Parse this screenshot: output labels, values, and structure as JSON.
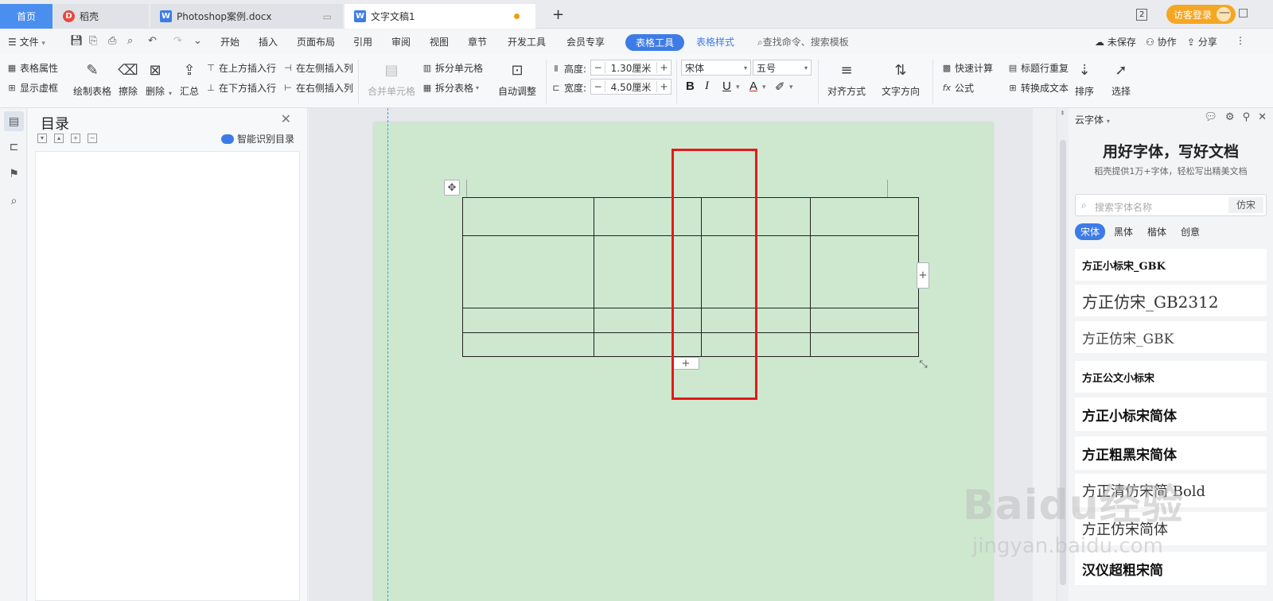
{
  "tabs": {
    "home": "首页",
    "daoke": "稻壳",
    "doc1": "Photoshop案例.docx",
    "doc2": "文字文稿1",
    "add": "+"
  },
  "titlebar": {
    "badge": "2",
    "visitor": "访客登录",
    "minimize": "—",
    "maximize": "□"
  },
  "menu": {
    "file": "文件",
    "items": [
      "开始",
      "插入",
      "页面布局",
      "引用",
      "审阅",
      "视图",
      "章节",
      "开发工具",
      "会员专享"
    ],
    "table_tools": "表格工具",
    "table_style": "表格样式",
    "search": "查找命令、搜索模板",
    "unsaved": "未保存",
    "collab": "协作",
    "share": "分享"
  },
  "ribbon": {
    "table_props": "表格属性",
    "show_grid": "显示虚框",
    "draw_table": "绘制表格",
    "erase": "擦除",
    "delete": "删除",
    "summary": "汇总",
    "insert_above": "在上方插入行",
    "insert_below": "在下方插入行",
    "insert_left": "在左侧插入列",
    "insert_right": "在右侧插入列",
    "merge_cells": "合并单元格",
    "split_cells": "拆分单元格",
    "split_table": "拆分表格",
    "auto_fit": "自动调整",
    "height_label": "高度:",
    "height_value": "1.30厘米",
    "width_label": "宽度:",
    "width_value": "4.50厘米",
    "font_name": "宋体",
    "font_size": "五号",
    "bold": "B",
    "italic": "I",
    "underline": "U",
    "font_color": "A",
    "align": "对齐方式",
    "text_dir": "文字方向",
    "quick_calc": "快速计算",
    "formula": "公式",
    "title_repeat": "标题行重复",
    "to_text": "转换成文本",
    "sort": "排序",
    "select": "选择"
  },
  "toc": {
    "title": "目录",
    "smart": "智能识别目录"
  },
  "font_panel": {
    "header": "云字体",
    "title": "用好字体，写好文档",
    "subtitle": "稻壳提供1万+字体，轻松写出精美文档",
    "search_placeholder": "搜索字体名称",
    "search_btn": "仿宋",
    "categories": [
      "宋体",
      "黑体",
      "楷体",
      "创意"
    ],
    "fonts": [
      "方正小标宋_GBK",
      "方正仿宋_GB2312",
      "方正仿宋_GBK",
      "方正公文小标宋",
      "方正小标宋简体",
      "方正粗黑宋简体",
      "方正清仿宋简 Bold",
      "方正仿宋简体",
      "汉仪超粗宋简"
    ]
  },
  "watermark": {
    "brand": "Baidu经验",
    "url": "jingyan.baidu.com"
  },
  "colors": {
    "accent": "#3d7ce6",
    "page_bg": "#cde8cf",
    "highlight": "#e01b1b"
  }
}
